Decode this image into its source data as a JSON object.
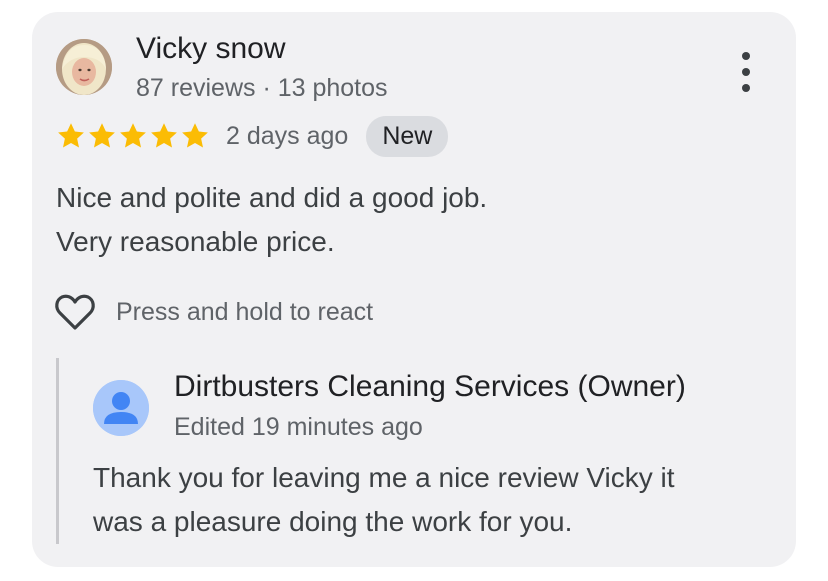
{
  "review": {
    "author": {
      "name": "Vicky snow",
      "meta": "87 reviews · 13 photos"
    },
    "rating": 5,
    "rating_max": 5,
    "time_ago": "2 days ago",
    "badge": "New",
    "text_lines": [
      "Nice and polite and did a good job.",
      "Very reasonable price."
    ],
    "react_label": "Press and hold to react"
  },
  "owner_response": {
    "name": "Dirtbusters Cleaning Services (Owner)",
    "meta": "Edited 19 minutes ago",
    "text_lines": [
      "Thank you for leaving me a nice review Vicky it",
      "was a pleasure doing the work for you."
    ]
  },
  "colors": {
    "card_bg": "#f1f1f3",
    "star": "#fbbc04",
    "badge_bg": "#dadce0",
    "owner_avatar_bg": "#a8c7fa",
    "owner_avatar_fg": "#4285f4",
    "reply_rule": "#c8c8cc"
  },
  "icons": {
    "more": "more-vert-icon",
    "star": "star-icon",
    "heart": "heart-outline-icon",
    "owner_avatar": "person-icon"
  }
}
